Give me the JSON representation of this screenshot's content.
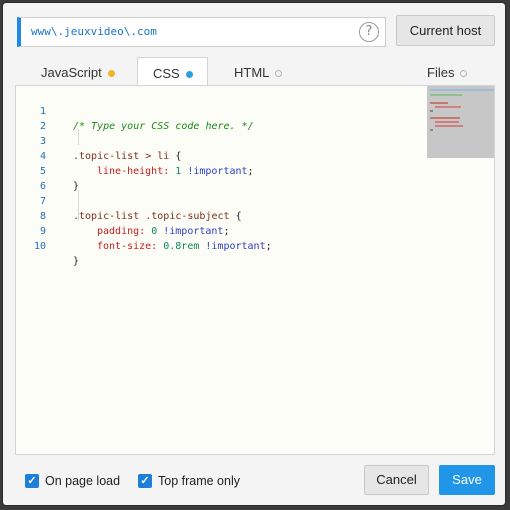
{
  "host": {
    "value": "www\\.jeuxvideo\\.com",
    "help_icon": "question-circle-icon",
    "current_host_label": "Current host"
  },
  "tabs": [
    {
      "label": "JavaScript",
      "status": "modified",
      "dot_color": "#f0b429"
    },
    {
      "label": "CSS",
      "status": "active",
      "dot_color": "#2d9ee0"
    },
    {
      "label": "HTML",
      "status": "empty"
    },
    {
      "label": "Files",
      "status": "empty"
    }
  ],
  "editor": {
    "line_numbers": [
      "1",
      "2",
      "3",
      "4",
      "5",
      "6",
      "7",
      "8",
      "9",
      "10"
    ],
    "lines": [
      {
        "comment": "/* Type your CSS code here. */"
      },
      {},
      {
        "selector": ".topic-list > li",
        "open": " {"
      },
      {
        "prop": "line-height:",
        "value": " 1",
        "important": " !important",
        "end": ";"
      },
      {
        "close": "}"
      },
      {},
      {
        "selector": ".topic-list .topic-subject",
        "open": " {"
      },
      {
        "prop": "padding:",
        "value": " 0",
        "important": " !important",
        "end": ";"
      },
      {
        "prop": "font-size:",
        "value": " 0.8rem",
        "important": " !important",
        "end": ";"
      },
      {
        "close": "}"
      }
    ]
  },
  "options": {
    "on_page_load": {
      "label": "On page load",
      "checked": true
    },
    "top_frame_only": {
      "label": "Top frame only",
      "checked": true
    }
  },
  "actions": {
    "cancel_label": "Cancel",
    "save_label": "Save"
  },
  "colors": {
    "accent": "#1e88e5",
    "save_button": "#2196e8"
  }
}
